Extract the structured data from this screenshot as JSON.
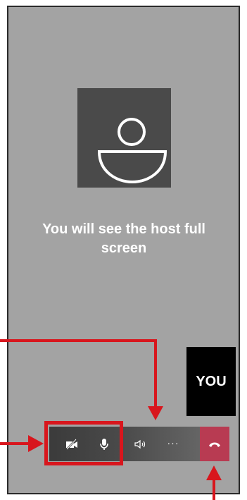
{
  "screen": {
    "host_message": "You will see the host full screen",
    "self_view_label": "YOU"
  },
  "toolbar": {
    "buttons": [
      {
        "name": "camera-off-icon",
        "label": ""
      },
      {
        "name": "microphone-icon",
        "label": ""
      },
      {
        "name": "speaker-icon",
        "label": ""
      },
      {
        "name": "more-options-icon",
        "label": "···"
      },
      {
        "name": "end-call-icon",
        "label": ""
      }
    ]
  },
  "colors": {
    "annotation": "#d8161d",
    "end_call": "#b83b52",
    "background": "#a3a3a3"
  }
}
